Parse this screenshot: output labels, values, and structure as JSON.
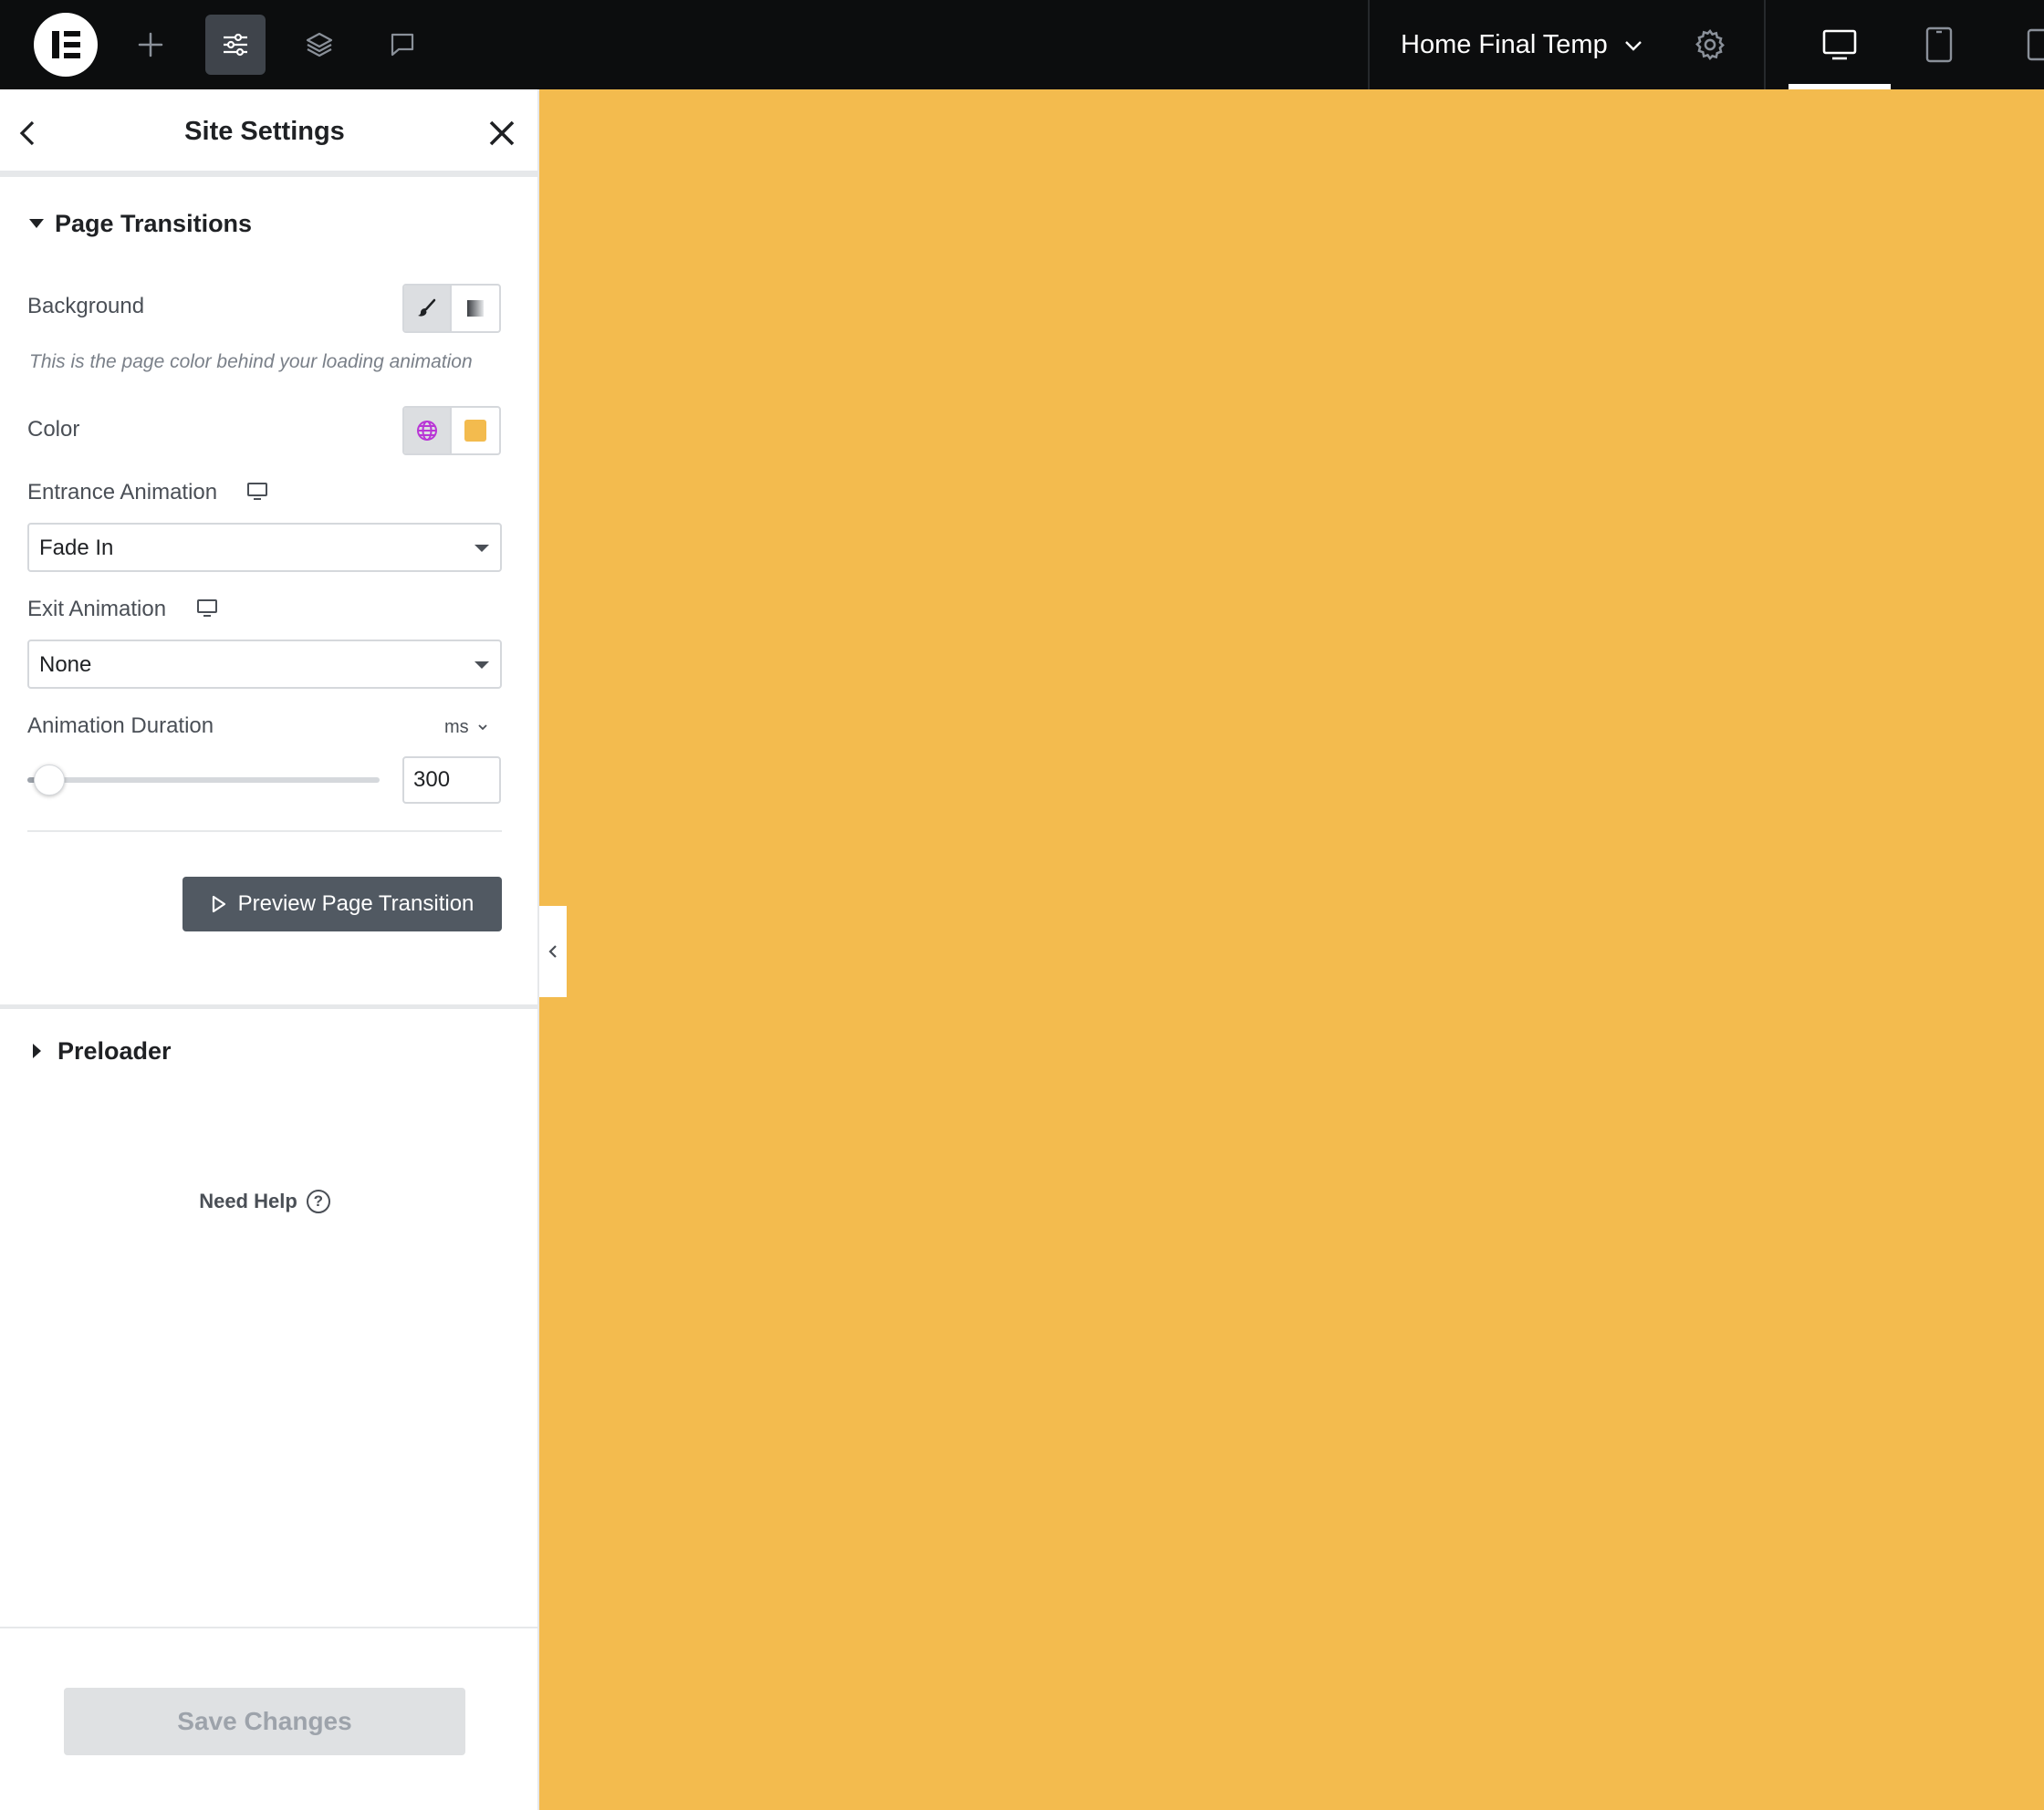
{
  "topbar": {
    "logo_icon": "elementor-logo-icon",
    "tools": [
      {
        "name": "add-element",
        "icon": "plus-icon"
      },
      {
        "name": "site-settings",
        "icon": "sliders-icon",
        "active": true
      },
      {
        "name": "structure",
        "icon": "layers-icon"
      },
      {
        "name": "comments",
        "icon": "chat-bubble-icon"
      }
    ],
    "document_title": "Home Final Temp",
    "devices": [
      "desktop",
      "tablet",
      "mobile"
    ],
    "active_device": "desktop"
  },
  "panel": {
    "title": "Site Settings",
    "sections": {
      "page_transitions": {
        "title": "Page Transitions",
        "expanded": true,
        "background_label": "Background",
        "background_description": "This is the page color behind your loading animation",
        "color_label": "Color",
        "color_value": "#F3BB4E",
        "entrance_animation_label": "Entrance Animation",
        "entrance_animation_value": "Fade In",
        "exit_animation_label": "Exit Animation",
        "exit_animation_value": "None",
        "duration_label": "Animation Duration",
        "duration_unit": "ms",
        "duration_value": "300",
        "preview_button": "Preview Page Transition"
      },
      "preloader": {
        "title": "Preloader",
        "expanded": false
      }
    },
    "help_label": "Need Help",
    "help_icon": "?",
    "save_button": "Save Changes"
  },
  "colors": {
    "topbar_bg": "#0C0D0E",
    "canvas_bg": "#F3BB4E",
    "global_color_icon": "#B936D6",
    "preview_button_bg": "#515962"
  }
}
